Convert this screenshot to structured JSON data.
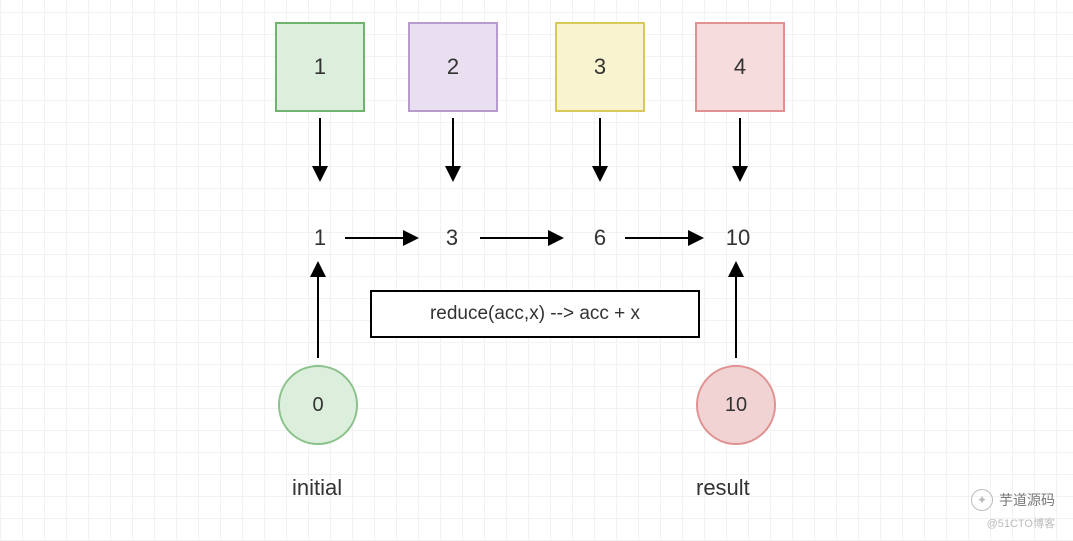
{
  "boxes": {
    "b1": "1",
    "b2": "2",
    "b3": "3",
    "b4": "4"
  },
  "sums": {
    "s1": "1",
    "s2": "3",
    "s3": "6",
    "s4": "10"
  },
  "fn": "reduce(acc,x) --> acc + x",
  "circles": {
    "initial": "0",
    "result": "10"
  },
  "labels": {
    "initial": "initial",
    "result": "result"
  },
  "wm": {
    "brand": "芋道源码",
    "site": "@51CTO博客"
  },
  "chart_data": {
    "type": "diagram",
    "operation": "reduce",
    "function": "acc + x",
    "initial": 0,
    "inputs": [
      1,
      2,
      3,
      4
    ],
    "accumulated": [
      1,
      3,
      6,
      10
    ],
    "result": 10
  }
}
